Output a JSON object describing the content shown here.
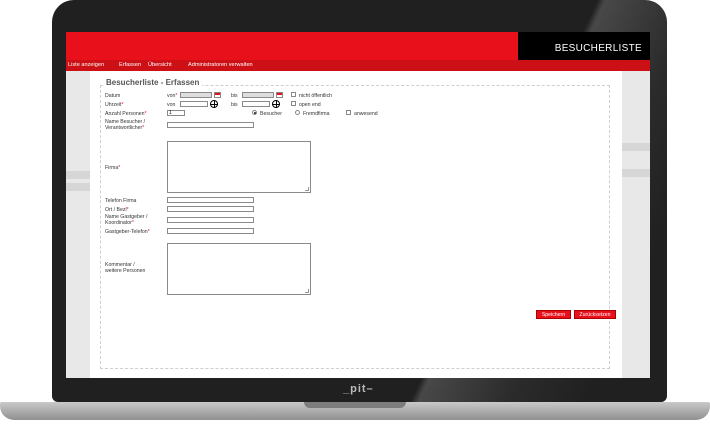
{
  "header": {
    "app_title": "BESUCHERLISTE"
  },
  "nav": {
    "items": [
      "Liste anzeigen",
      "Erfassen",
      "Übersicht",
      "Administratoren verwalten"
    ]
  },
  "form": {
    "legend": "Besucherliste - Erfassen",
    "datum": {
      "label": "Datum",
      "von": "von",
      "bis": "bis",
      "nicht_oeffentlich": "nicht öffentlich"
    },
    "uhrzeit": {
      "label": "Uhrzeit",
      "von": "von",
      "bis": "bis",
      "open_end": "open end"
    },
    "anzahl": {
      "label": "Anzahl Personen",
      "value": "1",
      "besucher": "Besucher",
      "fremdfirma": "Fremdfirma",
      "anwesend": "anwesend"
    },
    "name_besucher": {
      "line1": "Name Besucher /",
      "line2": "Verantwortlicher"
    },
    "firma": {
      "label": "Firma"
    },
    "telefon_firma": {
      "label": "Telefon Firma"
    },
    "ort": {
      "label": "Ort / Bezl"
    },
    "name_gastgeber": {
      "line1": "Name Gastgeber /",
      "line2": "Koordinator"
    },
    "gastgeber_telefon": {
      "label": "Gastgeber-Telefon"
    },
    "kommentar": {
      "line1": "Kommentar /",
      "line2": "weitere Personen"
    },
    "required_marker": "*"
  },
  "buttons": {
    "save": "Speichern",
    "reset": "Zurücksetzen"
  },
  "device": {
    "logo": "_pit–"
  },
  "colors": {
    "accent": "#e8101a",
    "title_bar": "#000000"
  }
}
